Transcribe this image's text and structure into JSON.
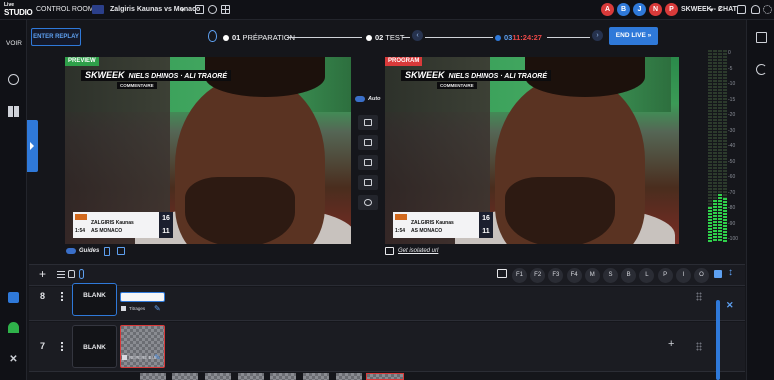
{
  "app": {
    "logo_line1": "Live",
    "logo_line2": "STUDIO"
  },
  "topbar": {
    "control_rooms": "CONTROL ROOMS",
    "match_title": "Zalgiris Kaunas vs Monaco",
    "caret": "▾",
    "room": "SKWEEK - 2",
    "room_caret": "▾",
    "chat": "CHAT",
    "avatars": [
      {
        "letter": "A",
        "color": "#d93a3a"
      },
      {
        "letter": "B",
        "color": "#2f79d9"
      },
      {
        "letter": "J",
        "color": "#2f79d9"
      },
      {
        "letter": "N",
        "color": "#d93a3a"
      },
      {
        "letter": "P",
        "color": "#d93a3a"
      }
    ]
  },
  "sidebar": {
    "voir": "VOIR"
  },
  "controls": {
    "enter_replay": "ENTER REPLAY",
    "step1_num": "01",
    "step1_label": "PRÉPARATION",
    "step2_num": "02",
    "step2_label": "TEST",
    "step3_num": "03",
    "step3_time": "11:24:27",
    "end_live": "END LIVE »",
    "auto_label": "Auto"
  },
  "preview": {
    "tag": "PREVIEW",
    "brand": "SKWEEK",
    "banner": "NIELS DHINOS · ALI TRAORÉ",
    "sub": "COMMENTAIRE",
    "team1": "ZALGIRIS Kaunas",
    "team2": "AS MONACO",
    "score1": "16",
    "score2": "11",
    "clock": "1:54"
  },
  "program": {
    "tag": "PROGRAM",
    "brand": "SKWEEK",
    "banner": "NIELS DHINOS · ALI TRAORÉ",
    "sub": "COMMENTAIRE",
    "team1": "ZALGIRIS Kaunas",
    "team2": "AS MONACO",
    "score1": "16",
    "score2": "11",
    "clock": "1:54"
  },
  "under_links": {
    "guides": "Guides",
    "isolated": "Get isolated url"
  },
  "meter_scale": [
    "0",
    "-5",
    "-10",
    "-15",
    "-20",
    "-30",
    "-40",
    "-50",
    "-60",
    "-70",
    "-80",
    "-90",
    "-100"
  ],
  "meter_levels": [
    0.18,
    0.22,
    0.25,
    0.23
  ],
  "function_buttons": [
    "F1",
    "F2",
    "F3",
    "F4",
    "M",
    "S",
    "B",
    "L",
    "P",
    "I",
    "O"
  ],
  "rows": [
    {
      "number": "8",
      "blank_label": "BLANK",
      "thumb_label": "Titrages"
    },
    {
      "number": "7",
      "blank_label": "BLANK",
      "thumb_label": "REPERE BUI"
    }
  ],
  "icons": {
    "grid": "grid-icon",
    "calendar": "calendar-icon",
    "settings": "gear-icon",
    "chat": "chat-icon",
    "user": "user-icon"
  }
}
